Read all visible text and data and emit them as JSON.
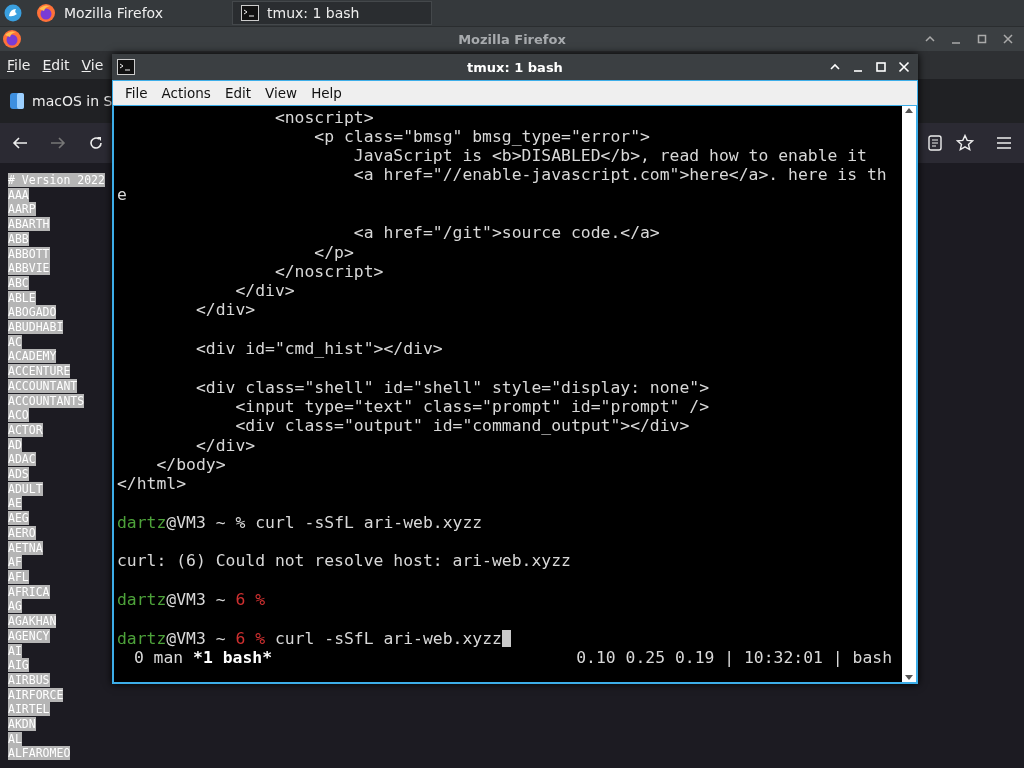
{
  "taskbar": {
    "tasks": [
      {
        "label": "Mozilla Firefox",
        "selected": false
      },
      {
        "label": "tmux: 1 bash",
        "selected": true
      }
    ]
  },
  "browser": {
    "title": "Mozilla Firefox",
    "menu": [
      "File",
      "Edit",
      "Vie"
    ],
    "tab": {
      "label": "macOS in S"
    },
    "page": {
      "highlighted": true,
      "lines": [
        "# Version 2022",
        "AAA",
        "AARP",
        "ABARTH",
        "ABB",
        "ABBOTT",
        "ABBVIE",
        "ABC",
        "ABLE",
        "ABOGADO",
        "ABUDHABI",
        "AC",
        "ACADEMY",
        "ACCENTURE",
        "ACCOUNTANT",
        "ACCOUNTANTS",
        "ACO",
        "ACTOR",
        "AD",
        "ADAC",
        "ADS",
        "ADULT",
        "AE",
        "AEG",
        "AERO",
        "AETNA",
        "AF",
        "AFL",
        "AFRICA",
        "AG",
        "AGAKHAN",
        "AGENCY",
        "AI",
        "AIG",
        "AIRBUS",
        "AIRFORCE",
        "AIRTEL",
        "AKDN",
        "AL",
        "ALFAROMEO"
      ]
    }
  },
  "terminal": {
    "title": "tmux: 1 bash",
    "menu": [
      "File",
      "Actions",
      "Edit",
      "View",
      "Help"
    ],
    "lines": [
      {
        "kind": "text",
        "text": "                <noscript>"
      },
      {
        "kind": "text",
        "text": "                    <p class=\"bmsg\" bmsg_type=\"error\">"
      },
      {
        "kind": "text",
        "text": "                        JavaScript is <b>DISABLED</b>, read how to enable it"
      },
      {
        "kind": "text",
        "text": "                        <a href=\"//enable-javascript.com\">here</a>. here is th"
      },
      {
        "kind": "text",
        "text": "e"
      },
      {
        "kind": "blank"
      },
      {
        "kind": "text",
        "text": "                        <a href=\"/git\">source code.</a>"
      },
      {
        "kind": "text",
        "text": "                    </p>"
      },
      {
        "kind": "text",
        "text": "                </noscript>"
      },
      {
        "kind": "text",
        "text": "            </div>"
      },
      {
        "kind": "text",
        "text": "        </div>"
      },
      {
        "kind": "blank"
      },
      {
        "kind": "text",
        "text": "        <div id=\"cmd_hist\"></div>"
      },
      {
        "kind": "blank"
      },
      {
        "kind": "text",
        "text": "        <div class=\"shell\" id=\"shell\" style=\"display: none\">"
      },
      {
        "kind": "text",
        "text": "            <input type=\"text\" class=\"prompt\" id=\"prompt\" />"
      },
      {
        "kind": "text",
        "text": "            <div class=\"output\" id=\"command_output\"></div>"
      },
      {
        "kind": "text",
        "text": "        </div>"
      },
      {
        "kind": "text",
        "text": "    </body>"
      },
      {
        "kind": "text",
        "text": "</html>"
      },
      {
        "kind": "blank"
      },
      {
        "kind": "prompt",
        "user": "dartz",
        "host": "@VM3 ~",
        "mark": "%",
        "error": false,
        "command": "curl -sSfL ari-web.xyzz",
        "cursor": false
      },
      {
        "kind": "blank"
      },
      {
        "kind": "text",
        "text": "curl: (6) Could not resolve host: ari-web.xyzz"
      },
      {
        "kind": "blank"
      },
      {
        "kind": "prompt",
        "user": "dartz",
        "host": "@VM3 ~",
        "mark": "6 %",
        "error": true,
        "cursor": false
      },
      {
        "kind": "blank"
      },
      {
        "kind": "prompt",
        "user": "dartz",
        "host": "@VM3 ~",
        "mark": "6 %",
        "error": true,
        "command": "curl -sSfL ari-web.xyzz",
        "cursor": true
      }
    ],
    "status": {
      "windows": [
        {
          "label": "0 man",
          "selected": false
        },
        {
          "label": "*1 bash*",
          "selected": true
        }
      ],
      "right": "0.10 0.25 0.19 | 10:32:01 | bash"
    }
  }
}
